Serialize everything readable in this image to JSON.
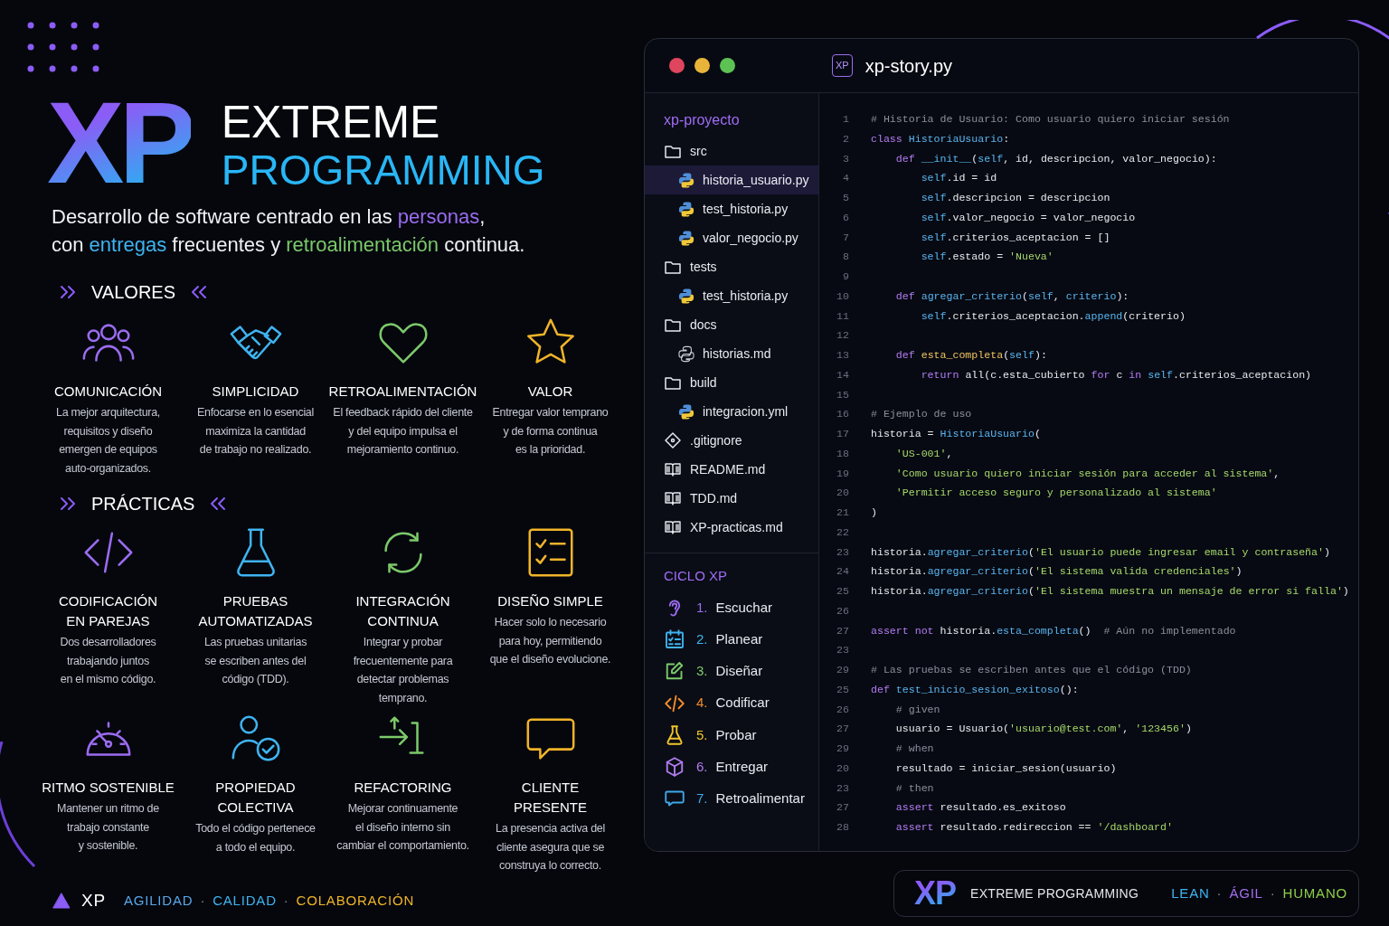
{
  "hero": {
    "logo": "XP",
    "title_line1": "EXTREME",
    "title_line2": "PROGRAMMING",
    "tagline": [
      [
        {
          "text": "Desarrollo de software centrado en las "
        },
        {
          "text": "personas",
          "color": "#9b6cf0"
        },
        {
          "text": ","
        }
      ],
      [
        {
          "text": "con "
        },
        {
          "text": "entregas",
          "color": "#3fb4f0"
        },
        {
          "text": " frecuentes y "
        },
        {
          "text": "retroalimentación",
          "color": "#7cc96a"
        },
        {
          "text": " continua."
        }
      ]
    ]
  },
  "values": {
    "title": "VALORES",
    "items": [
      {
        "title": "COMUNICACIÓN",
        "text": "La mejor arquitectura,\nrequisitos y diseño\nemergen de equipos\nauto-organizados.",
        "color": "#9b6cf0"
      },
      {
        "title": "SIMPLICIDAD",
        "text": "Enfocarse en lo esencial\nmaximiza la cantidad\nde trabajo no realizado.",
        "color": "#3fb4f0"
      },
      {
        "title": "RETROALIMENTACIÓN",
        "text": "El feedback rápido del cliente\ny del equipo impulsa el\nmejoramiento continuo.",
        "color": "#7cc96a"
      },
      {
        "title": "VALOR",
        "text": "Entregar valor temprano\ny de forma continua\nes la prioridad.",
        "color": "#f0b429"
      }
    ]
  },
  "practices": {
    "title": "PRÁCTICAS",
    "items": [
      {
        "title": "CODIFICACIÓN\nEN PAREJAS",
        "text": "Dos desarrolladores\ntrabajando juntos\nen el mismo código.",
        "color": "#9b6cf0"
      },
      {
        "title": "PRUEBAS\nAUTOMATIZADAS",
        "text": "Las pruebas unitarias\nse escriben antes del\ncódigo (TDD).",
        "color": "#3fb4f0"
      },
      {
        "title": "INTEGRACIÓN\nCONTINUA",
        "text": "Integrar y probar\nfrecuentemente para\ndetectar problemas\ntemprano.",
        "color": "#7cc96a"
      },
      {
        "title": "DISEÑO SIMPLE",
        "text": "Hacer solo lo necesario\npara hoy, permitiendo\nque el diseño evolucione.",
        "color": "#f0b429"
      },
      {
        "title": "RITMO SOSTENIBLE",
        "text": "Mantener un ritmo de\ntrabajo constante\ny sostenible.",
        "color": "#9b6cf0"
      },
      {
        "title": "PROPIEDAD\nCOLECTIVA",
        "text": "Todo el código pertenece\na todo el equipo.",
        "color": "#3fb4f0"
      },
      {
        "title": "REFACTORING",
        "text": "Mejorar continuamente\nel diseño interno sin\ncambiar el comportamiento.",
        "color": "#7cc96a"
      },
      {
        "title": "CLIENTE\nPRESENTE",
        "text": "La presencia activa del\ncliente asegura que se\nconstruya lo correcto.",
        "color": "#f0b429"
      }
    ]
  },
  "footer": {
    "logo": "XP",
    "tags": [
      {
        "text": "AGILIDAD",
        "color": "#5aa7e8"
      },
      {
        "text": "·"
      },
      {
        "text": "CALIDAD",
        "color": "#3fb4f0"
      },
      {
        "text": "·"
      },
      {
        "text": "COLABORACIÓN",
        "color": "#f0b429"
      }
    ]
  },
  "editor": {
    "badge": "XP",
    "title": "xp-story.py",
    "project": "xp-proyecto",
    "tree": [
      {
        "label": "src",
        "kind": "folder",
        "selected": false,
        "children": [
          {
            "label": "historia_usuario.py",
            "kind": "python",
            "selected": true
          },
          {
            "label": "test_historia.py",
            "kind": "python",
            "selected": false
          },
          {
            "label": "valor_negocio.py",
            "kind": "python",
            "selected": false
          }
        ]
      },
      {
        "label": "tests",
        "kind": "folder",
        "selected": false,
        "children": [
          {
            "label": "test_historia.py",
            "kind": "python",
            "selected": false
          }
        ]
      },
      {
        "label": "docs",
        "kind": "folder",
        "selected": false,
        "children": [
          {
            "label": "historias.md",
            "kind": "doc",
            "selected": false
          }
        ]
      },
      {
        "label": "build",
        "kind": "folder",
        "selected": false,
        "children": [
          {
            "label": "integracion.yml",
            "kind": "python",
            "selected": false
          }
        ]
      },
      {
        "label": ".gitignore",
        "kind": "diamond",
        "selected": false
      },
      {
        "label": "README.md",
        "kind": "book",
        "selected": false
      },
      {
        "label": "TDD.md",
        "kind": "book",
        "selected": false
      },
      {
        "label": "XP-practicas.md",
        "kind": "book",
        "selected": false
      }
    ],
    "cycle_title": "CICLO XP",
    "cycle": [
      {
        "number": "1.",
        "label": "Escuchar",
        "color": "#9b6cf0"
      },
      {
        "number": "2.",
        "label": "Planear",
        "color": "#3fb4f0"
      },
      {
        "number": "3.",
        "label": "Diseñar",
        "color": "#7cc96a"
      },
      {
        "number": "4.",
        "label": "Codificar",
        "color": "#f08c29"
      },
      {
        "number": "5.",
        "label": "Probar",
        "color": "#f0c429"
      },
      {
        "number": "6.",
        "label": "Entregar",
        "color": "#b07cf0"
      },
      {
        "number": "7.",
        "label": "Retroalimentar",
        "color": "#3fa8e8"
      }
    ],
    "code": [
      {
        "number": "1",
        "tokens": [
          {
            "kind": "comment",
            "text": "# Historia de Usuario: Como usuario quiero iniciar sesión"
          }
        ]
      },
      {
        "number": "2",
        "tokens": [
          {
            "kind": "keyword",
            "text": "class "
          },
          {
            "kind": "name",
            "text": "HistoriaUsuario"
          },
          {
            "kind": "plain",
            "text": ":"
          }
        ]
      },
      {
        "number": "3",
        "tokens": [
          {
            "kind": "keyword",
            "text": "    def "
          },
          {
            "kind": "name",
            "text": "__init__"
          },
          {
            "kind": "plain",
            "text": "("
          },
          {
            "kind": "self",
            "text": "self"
          },
          {
            "kind": "plain",
            "text": ", id, descripcion, valor_negocio):"
          }
        ]
      },
      {
        "number": "4",
        "tokens": [
          {
            "kind": "self",
            "text": "        self"
          },
          {
            "kind": "plain",
            "text": ".id = id"
          }
        ]
      },
      {
        "number": "5",
        "tokens": [
          {
            "kind": "self",
            "text": "        self"
          },
          {
            "kind": "plain",
            "text": ".descripcion = descripcion"
          }
        ]
      },
      {
        "number": "6",
        "tokens": [
          {
            "kind": "self",
            "text": "        self"
          },
          {
            "kind": "plain",
            "text": ".valor_negocio = valor_negocio"
          }
        ]
      },
      {
        "number": "7",
        "tokens": [
          {
            "kind": "self",
            "text": "        self"
          },
          {
            "kind": "plain",
            "text": ".criterios_aceptacion = []"
          }
        ]
      },
      {
        "number": "8",
        "tokens": [
          {
            "kind": "self",
            "text": "        self"
          },
          {
            "kind": "plain",
            "text": ".estado = "
          },
          {
            "kind": "string",
            "text": "'Nueva'"
          }
        ]
      },
      {
        "number": "9"
      },
      {
        "number": "10",
        "tokens": [
          {
            "kind": "keyword",
            "text": "    def "
          },
          {
            "kind": "name",
            "text": "agregar_criterio"
          },
          {
            "kind": "plain",
            "text": "("
          },
          {
            "kind": "self",
            "text": "self"
          },
          {
            "kind": "plain",
            "text": ", "
          },
          {
            "kind": "self",
            "text": "criterio"
          },
          {
            "kind": "plain",
            "text": "):"
          }
        ]
      },
      {
        "number": "11",
        "tokens": [
          {
            "kind": "self",
            "text": "        self"
          },
          {
            "kind": "plain",
            "text": ".criterios_aceptacion."
          },
          {
            "kind": "name",
            "text": "append"
          },
          {
            "kind": "plain",
            "text": "(criterio)"
          }
        ]
      },
      {
        "number": "12"
      },
      {
        "number": "13",
        "tokens": [
          {
            "kind": "keyword",
            "text": "    def "
          },
          {
            "kind": "method",
            "text": "esta_completa"
          },
          {
            "kind": "plain",
            "text": "("
          },
          {
            "kind": "self",
            "text": "self"
          },
          {
            "kind": "plain",
            "text": "):"
          }
        ]
      },
      {
        "number": "14",
        "tokens": [
          {
            "kind": "keyword",
            "text": "        return "
          },
          {
            "kind": "plain",
            "text": "all(c.esta_cubierto "
          },
          {
            "kind": "keyword",
            "text": "for "
          },
          {
            "kind": "plain",
            "text": "c "
          },
          {
            "kind": "keyword",
            "text": "in "
          },
          {
            "kind": "self",
            "text": "self"
          },
          {
            "kind": "plain",
            "text": ".criterios_aceptacion)"
          }
        ]
      },
      {
        "number": "15"
      },
      {
        "number": "16",
        "tokens": [
          {
            "kind": "comment",
            "text": "# Ejemplo de uso"
          }
        ]
      },
      {
        "number": "17",
        "tokens": [
          {
            "kind": "plain",
            "text": "historia = "
          },
          {
            "kind": "name",
            "text": "HistoriaUsuario"
          },
          {
            "kind": "plain",
            "text": "("
          }
        ]
      },
      {
        "number": "18",
        "tokens": [
          {
            "kind": "string",
            "text": "    'US-001'"
          },
          {
            "kind": "plain",
            "text": ","
          }
        ]
      },
      {
        "number": "19",
        "tokens": [
          {
            "kind": "string",
            "text": "    'Como usuario quiero iniciar sesión para acceder al sistema'"
          },
          {
            "kind": "plain",
            "text": ","
          }
        ]
      },
      {
        "number": "20",
        "tokens": [
          {
            "kind": "string",
            "text": "    'Permitir acceso seguro y personalizado al sistema'"
          }
        ]
      },
      {
        "number": "21",
        "tokens": [
          {
            "kind": "plain",
            "text": ")"
          }
        ]
      },
      {
        "number": "22"
      },
      {
        "number": "23",
        "tokens": [
          {
            "kind": "plain",
            "text": "historia."
          },
          {
            "kind": "name",
            "text": "agregar_criterio"
          },
          {
            "kind": "plain",
            "text": "("
          },
          {
            "kind": "string",
            "text": "'El usuario puede ingresar email y contraseña'"
          },
          {
            "kind": "plain",
            "text": ")"
          }
        ]
      },
      {
        "number": "24",
        "tokens": [
          {
            "kind": "plain",
            "text": "historia."
          },
          {
            "kind": "name",
            "text": "agregar_criterio"
          },
          {
            "kind": "plain",
            "text": "("
          },
          {
            "kind": "string",
            "text": "'El sistema valida credenciales'"
          },
          {
            "kind": "plain",
            "text": ")"
          }
        ]
      },
      {
        "number": "25",
        "tokens": [
          {
            "kind": "plain",
            "text": "historia."
          },
          {
            "kind": "name",
            "text": "agregar_criterio"
          },
          {
            "kind": "plain",
            "text": "("
          },
          {
            "kind": "string",
            "text": "'El sistema muestra un mensaje de error si falla'"
          },
          {
            "kind": "plain",
            "text": ")"
          }
        ]
      },
      {
        "number": "26"
      },
      {
        "number": "27",
        "tokens": [
          {
            "kind": "keyword",
            "text": "assert not "
          },
          {
            "kind": "plain",
            "text": "historia."
          },
          {
            "kind": "name",
            "text": "esta_completa"
          },
          {
            "kind": "plain",
            "text": "()  "
          },
          {
            "kind": "comment",
            "text": "# Aún no implementado"
          }
        ]
      },
      {
        "number": "23"
      },
      {
        "number": "29",
        "tokens": [
          {
            "kind": "comment",
            "text": "# Las pruebas se escriben antes que el código (TDD)"
          }
        ]
      },
      {
        "number": "25",
        "tokens": [
          {
            "kind": "keyword",
            "text": "def "
          },
          {
            "kind": "name",
            "text": "test_inicio_sesion_exitoso"
          },
          {
            "kind": "plain",
            "text": "():"
          }
        ]
      },
      {
        "number": "26",
        "tokens": [
          {
            "kind": "comment",
            "text": "    # given"
          }
        ]
      },
      {
        "number": "27",
        "tokens": [
          {
            "kind": "plain",
            "text": "    usuario = Usuario("
          },
          {
            "kind": "string",
            "text": "'usuario@test.com'"
          },
          {
            "kind": "plain",
            "text": ", "
          },
          {
            "kind": "string",
            "text": "'123456'"
          },
          {
            "kind": "plain",
            "text": ")"
          }
        ]
      },
      {
        "number": "29",
        "tokens": [
          {
            "kind": "comment",
            "text": "    # when"
          }
        ]
      },
      {
        "number": "20",
        "tokens": [
          {
            "kind": "plain",
            "text": "    resultado = iniciar_sesion(usuario)"
          }
        ]
      },
      {
        "number": "23",
        "tokens": [
          {
            "kind": "comment",
            "text": "    # then"
          }
        ]
      },
      {
        "number": "27",
        "tokens": [
          {
            "kind": "keyword",
            "text": "    assert "
          },
          {
            "kind": "plain",
            "text": "resultado.es_exitoso"
          }
        ]
      },
      {
        "number": "28",
        "tokens": [
          {
            "kind": "keyword",
            "text": "    assert "
          },
          {
            "kind": "plain",
            "text": "resultado.redireccion == "
          },
          {
            "kind": "string",
            "text": "'/dashboard'"
          }
        ]
      }
    ]
  },
  "banner": {
    "logo": "XP",
    "title": "EXTREME PROGRAMMING",
    "tags": [
      {
        "text": "LEAN",
        "color": "#3fb4f0"
      },
      {
        "text": "·"
      },
      {
        "text": "ÁGIL",
        "color": "#a56cf0"
      },
      {
        "text": "·"
      },
      {
        "text": "HUMANO",
        "color": "#8ccf4a"
      }
    ]
  }
}
